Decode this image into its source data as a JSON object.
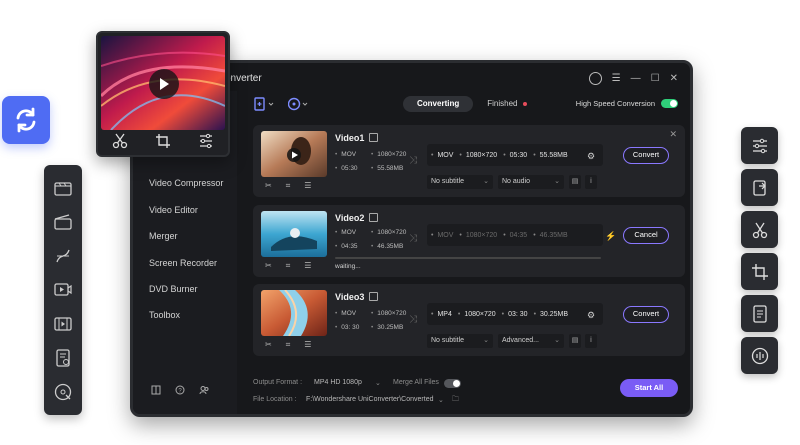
{
  "window": {
    "title": "onverter"
  },
  "tabs": [
    {
      "label": "Converting",
      "active": true
    },
    {
      "label": "Finished",
      "active": false
    }
  ],
  "high_speed": {
    "label": "High Speed Conversion",
    "on": true
  },
  "sidebar": {
    "items": [
      {
        "label": "Video Compressor"
      },
      {
        "label": "Video Editor"
      },
      {
        "label": "Merger"
      },
      {
        "label": "Screen Recorder"
      },
      {
        "label": "DVD Burner"
      },
      {
        "label": "Toolbox"
      }
    ]
  },
  "videos": [
    {
      "name": "Video1",
      "src_format": "MOV",
      "src_res": "1080×720",
      "src_dur": "05:30",
      "src_size": "55.58MB",
      "dst_format": "MOV",
      "dst_res": "1080×720",
      "dst_dur": "05:30",
      "dst_size": "55.58MB",
      "subtitle": "No subtitle",
      "audio": "No audio",
      "action": "Convert"
    },
    {
      "name": "Video2",
      "src_format": "MOV",
      "src_res": "1080×720",
      "src_dur": "04:35",
      "src_size": "46.35MB",
      "dst_format": "MOV",
      "dst_res": "1080×720",
      "dst_dur": "04:35",
      "dst_size": "46.35MB",
      "status": "waiting...",
      "action": "Cancel"
    },
    {
      "name": "Video3",
      "src_format": "MOV",
      "src_res": "1080×720",
      "src_dur": "03: 30",
      "src_size": "30.25MB",
      "dst_format": "MP4",
      "dst_res": "1080×720",
      "dst_dur": "03: 30",
      "dst_size": "30.25MB",
      "subtitle": "No subtitle",
      "audio": "Advanced...",
      "action": "Convert"
    }
  ],
  "footer": {
    "output_format_label": "Output Format :",
    "output_format_value": "MP4 HD 1080p",
    "merge_label": "Merge All Files",
    "merge_on": false,
    "file_location_label": "File Location :",
    "file_location_value": "F:\\Wondershare UniConverter\\Converted",
    "start_all": "Start All"
  },
  "colors": {
    "accent": "#7a5cf5",
    "toggle_on": "#2fcf7a",
    "sync_badge": "#4f6cf3"
  }
}
